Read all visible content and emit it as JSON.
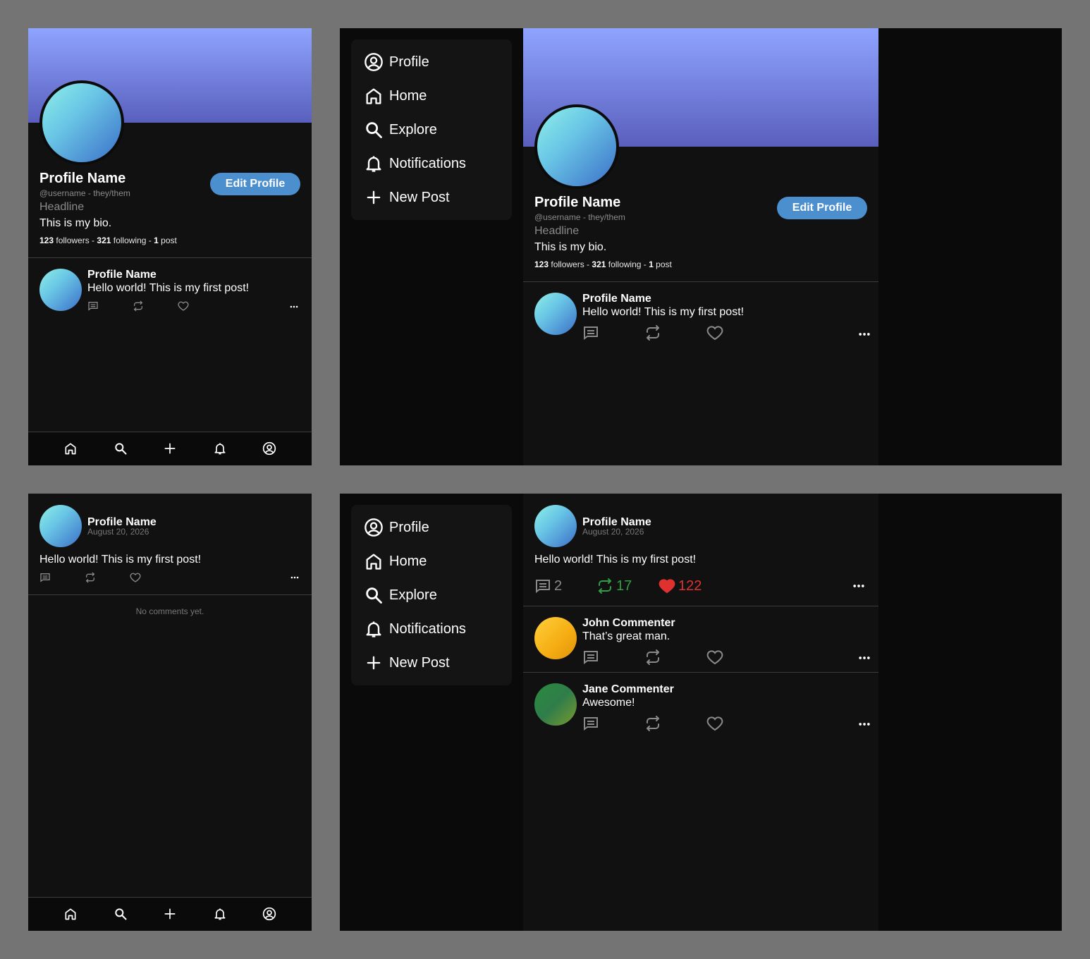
{
  "profile": {
    "name": "Profile Name",
    "username_line": "@username - they/them",
    "headline": "Headline",
    "bio": "This is my bio.",
    "followers_count": "123",
    "followers_label": " followers - ",
    "following_count": "321",
    "following_label": " following - ",
    "posts_count": "1",
    "posts_label": " post",
    "edit_button": "Edit Profile"
  },
  "post": {
    "author": "Profile Name",
    "text": "Hello world! This is my first post!",
    "date": "August 20, 2026",
    "comments": "2",
    "reposts": "17",
    "likes": "122"
  },
  "comments": [
    {
      "author": "John Commenter",
      "text": "That’s great man."
    },
    {
      "author": "Jane Commenter",
      "text": "Awesome!"
    }
  ],
  "no_comments": "No comments yet.",
  "sidebar": {
    "items": [
      {
        "label": "Profile",
        "icon": "profile-icon"
      },
      {
        "label": "Home",
        "icon": "home-icon"
      },
      {
        "label": "Explore",
        "icon": "search-icon"
      },
      {
        "label": "Notifications",
        "icon": "bell-icon"
      },
      {
        "label": "New Post",
        "icon": "plus-icon"
      }
    ]
  },
  "bottom_nav": [
    "home-icon",
    "search-icon",
    "plus-icon",
    "bell-icon",
    "profile-icon"
  ],
  "colors": {
    "banner_top": "#8ea4ff",
    "banner_bottom": "#5a5fbd",
    "button": "#4c8fcf",
    "repost_active": "#2f9e44",
    "like_active": "#e03131"
  }
}
